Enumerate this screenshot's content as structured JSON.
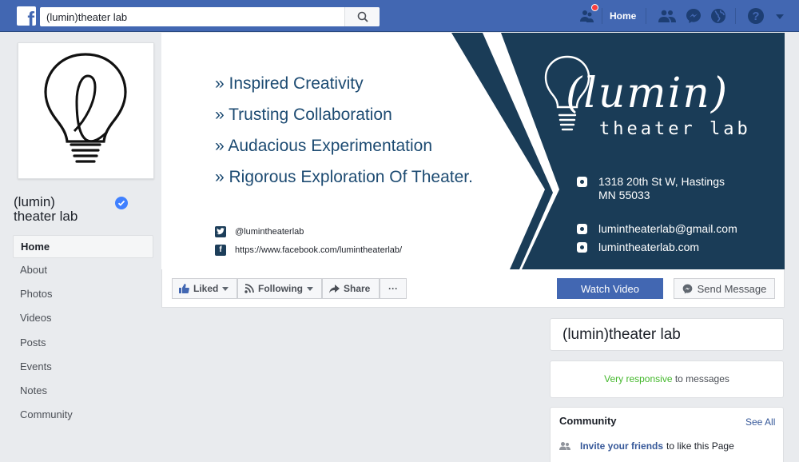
{
  "topbar": {
    "search_value": "(lumin)theater lab",
    "home_label": "Home"
  },
  "page": {
    "name": "(lumin)\ntheater lab",
    "name_line1": "(lumin)",
    "name_line2": "theater lab"
  },
  "nav": {
    "items": [
      "Home",
      "About",
      "Photos",
      "Videos",
      "Posts",
      "Events",
      "Notes",
      "Community"
    ]
  },
  "cover": {
    "values": [
      "» Inspired Creativity",
      "» Trusting Collaboration",
      "» Audacious Experimentation",
      "» Rigorous Exploration Of Theater."
    ],
    "twitter": "@lumintheaterlab",
    "facebook_url": "https://www.facebook.com/lumintheaterlab/",
    "brand_top": "(lumin)",
    "brand_bottom": "theater lab",
    "address_line1": "1318 20th St W, Hastings",
    "address_line2": "MN 55033",
    "email": "lumintheaterlab@gmail.com",
    "website": "lumintheaterlab.com",
    "colors": {
      "navy": "#1a3c57",
      "text_blue": "#1d4b72"
    }
  },
  "actions": {
    "liked": "Liked",
    "following": "Following",
    "share": "Share",
    "more": "···",
    "watch_video": "Watch Video",
    "send_message": "Send Message"
  },
  "sidebar_right": {
    "title": "(lumin)theater lab",
    "responsive_strong": "Very responsive",
    "responsive_rest": " to messages",
    "community_title": "Community",
    "see_all": "See All",
    "invite_link": "Invite your friends",
    "invite_rest": "to like this Page"
  },
  "colors": {
    "fb_blue": "#4267b2",
    "page_bg": "#e9ebee",
    "link": "#365899",
    "green": "#42b72a",
    "verified": "#4080ff"
  }
}
